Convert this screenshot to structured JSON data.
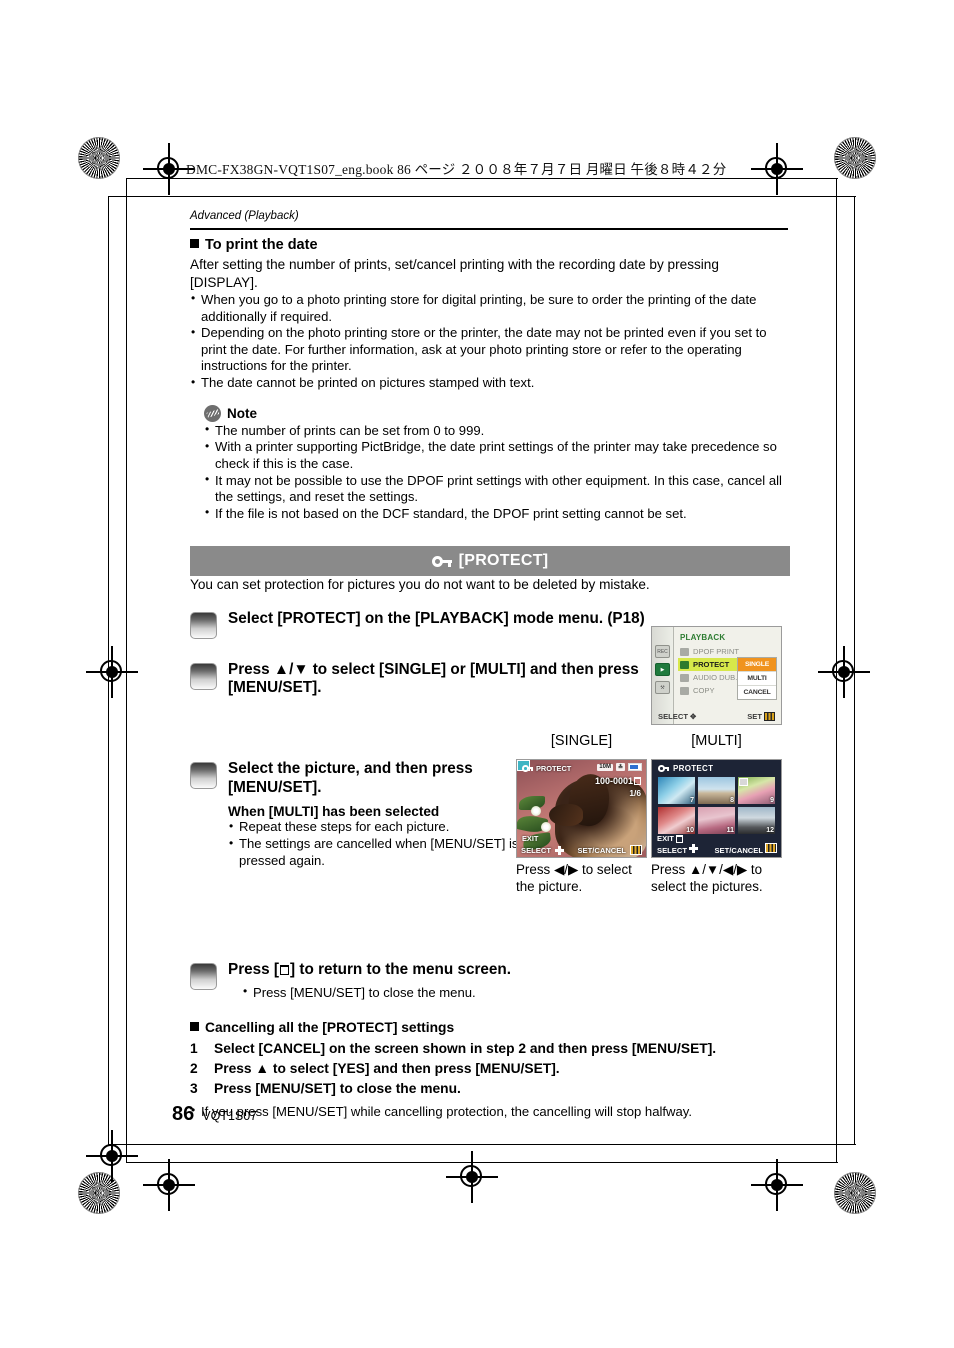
{
  "file_header": "DMC-FX38GN-VQT1S07_eng.book   86 ページ   ２００８年７月７日   月曜日   午後８時４２分",
  "running_head": "Advanced (Playback)",
  "print_date_section": {
    "heading": "To print the date",
    "body": "After setting the number of prints, set/cancel printing with the recording date by pressing [DISPLAY].",
    "bullets": [
      "When you go to a photo printing store for digital printing, be sure to order the printing of the date additionally if required.",
      "Depending on the photo printing store or the printer, the date may not be printed even if you set to print the date. For further information, ask at your photo printing store or refer to the operating instructions for the printer.",
      "The date cannot be printed on pictures stamped with text."
    ]
  },
  "note": {
    "title": "Note",
    "bullets": [
      "The number of prints can be set from 0 to 999.",
      "With a printer supporting PictBridge, the date print settings of the printer may take precedence so check if this is the case.",
      "It may not be possible to use the DPOF print settings with other equipment. In this case, cancel all the settings, and reset the settings.",
      "If the file is not based on the DCF standard, the DPOF print setting cannot be set."
    ]
  },
  "protect": {
    "band_title": "[PROTECT]",
    "band_icon": "key-icon",
    "intro": "You can set protection for pictures you do not want to be deleted by mistake.",
    "steps": [
      {
        "text": "Select [PROTECT] on the [PLAYBACK] mode menu. (P18)"
      },
      {
        "text": "Press ▲/▼ to select [SINGLE] or [MULTI] and then press [MENU/SET]."
      },
      {
        "text": "Select the picture, and then press [MENU/SET].",
        "subheading": "When [MULTI] has been selected",
        "notes": [
          "Repeat these steps for each picture.",
          "The settings are cancelled when [MENU/SET] is pressed again."
        ]
      },
      {
        "text_before": "Press [",
        "text_after": "] to return to the menu screen.",
        "notes": [
          "Press [MENU/SET] to close the menu."
        ]
      }
    ]
  },
  "menu_screen": {
    "title": "PLAYBACK",
    "side_icons": [
      "rec-icon",
      "playback-icon",
      "wrench-icon"
    ],
    "rows": [
      {
        "label": "DPOF PRINT",
        "icon": "printer-icon",
        "selected": false
      },
      {
        "label": "PROTECT",
        "icon": "key-icon",
        "selected": true
      },
      {
        "label": "AUDIO DUB.",
        "icon": "microphone-icon",
        "selected": false
      },
      {
        "label": "COPY",
        "icon": "copy-icon",
        "selected": false
      }
    ],
    "submenu": [
      {
        "label": "SINGLE",
        "active": true
      },
      {
        "label": "MULTI",
        "active": false
      },
      {
        "label": "CANCEL",
        "active": false
      }
    ],
    "footer_left": "SELECT",
    "footer_right": "SET"
  },
  "figures": {
    "single_label": "[SINGLE]",
    "multi_label": "[MULTI]",
    "single_caption": "Press ◀/▶ to select the picture.",
    "multi_caption": "Press ▲/▼/◀/▶ to select the pictures."
  },
  "single_screen": {
    "title": "PROTECT",
    "resolution": "10M",
    "quality": "fine-icon",
    "battery": "battery-icon",
    "file_number": "100-0001",
    "counter": "1/6",
    "exit_label": "EXIT",
    "select_label": "SELECT",
    "setcancel_label": "SET/CANCEL"
  },
  "multi_screen": {
    "title": "PROTECT",
    "thumbnails": [
      {
        "number": "7",
        "protected": false
      },
      {
        "number": "8",
        "protected": false
      },
      {
        "number": "9",
        "protected": true
      },
      {
        "number": "10",
        "protected": false
      },
      {
        "number": "11",
        "protected": false
      },
      {
        "number": "12",
        "protected": false
      }
    ],
    "exit_label": "EXIT",
    "select_label": "SELECT",
    "setcancel_label": "SET/CANCEL"
  },
  "cancelling": {
    "heading": "Cancelling all the [PROTECT] settings",
    "items": [
      {
        "n": "1",
        "text": "Select [CANCEL] on the screen shown in step 2 and then press [MENU/SET]."
      },
      {
        "n": "2",
        "text": "Press ▲ to select [YES] and then press [MENU/SET]."
      },
      {
        "n": "3",
        "text": "Press [MENU/SET] to close the menu."
      }
    ],
    "tail_note": "If you press [MENU/SET] while cancelling protection, the cancelling will stop halfway."
  },
  "footer": {
    "page_number": "86",
    "doc_code": "VQT1S07"
  }
}
